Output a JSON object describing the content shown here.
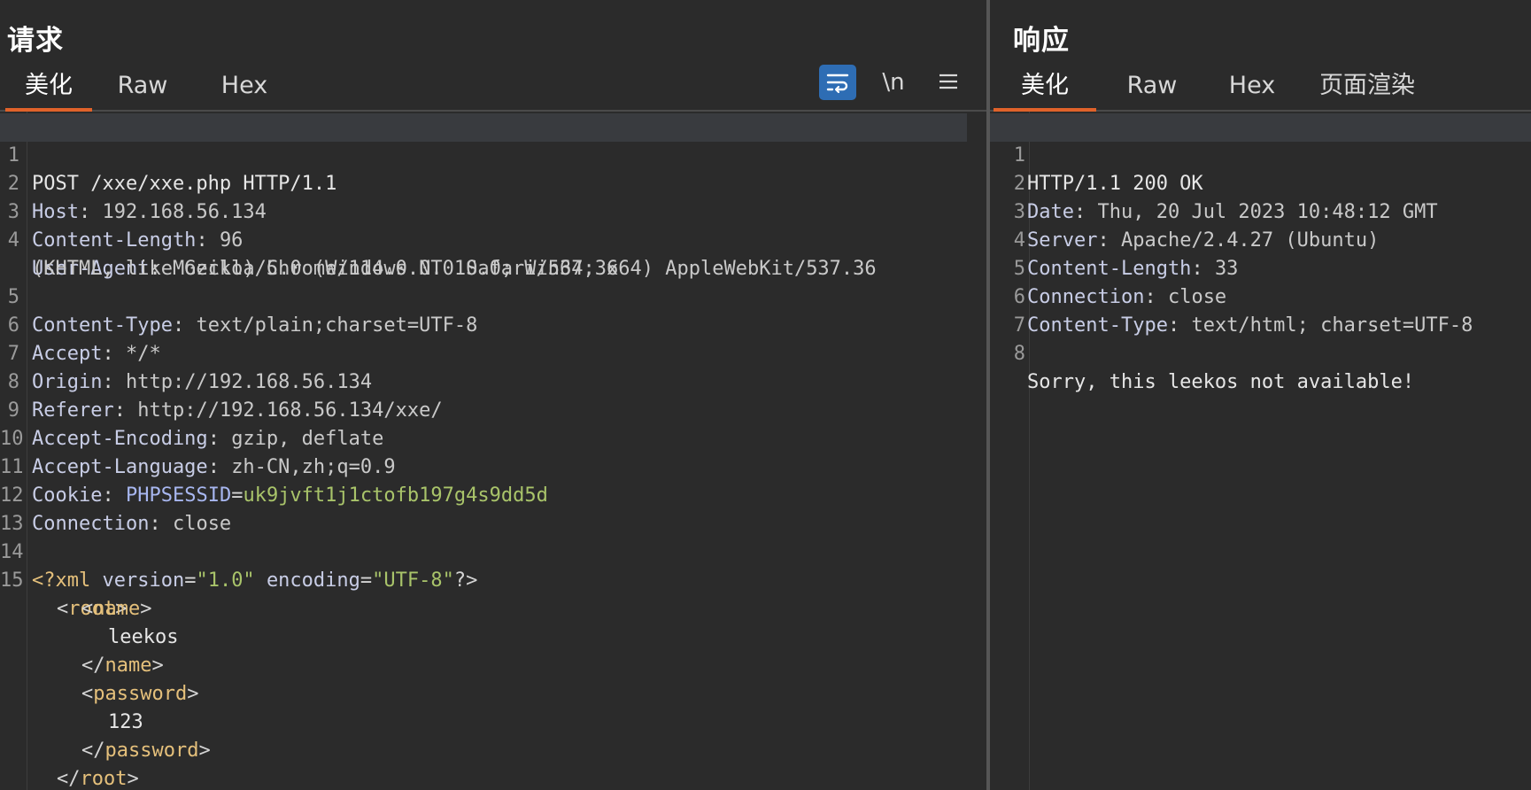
{
  "request": {
    "title": "请求",
    "tabs": [
      "美化",
      "Raw",
      "Hex"
    ],
    "tools": {
      "wrap": "wrap-icon",
      "newline": "\\n",
      "menu": "menu-icon"
    },
    "line_numbers": [
      "1",
      "2",
      "3",
      "4",
      "5",
      "6",
      "7",
      "8",
      "9",
      "10",
      "11",
      "12",
      "13",
      "14",
      "15"
    ],
    "request_line": "POST /xxe/xxe.php HTTP/1.1",
    "headers": [
      {
        "key": "Host",
        "value": "192.168.56.134"
      },
      {
        "key": "Content-Length",
        "value": "96"
      },
      {
        "key": "User-Agent",
        "value": "Mozilla/5.0 (Windows NT 10.0; Win64; x64) AppleWebKit/537.36"
      },
      {
        "key": "",
        "value": "(KHTML, like Gecko) Chrome/114.0.0.0 Safari/537.36"
      },
      {
        "key": "Content-Type",
        "value": "text/plain;charset=UTF-8"
      },
      {
        "key": "Accept",
        "value": "*/*"
      },
      {
        "key": "Origin",
        "value": "http://192.168.56.134"
      },
      {
        "key": "Referer",
        "value": "http://192.168.56.134/xxe/"
      },
      {
        "key": "Accept-Encoding",
        "value": "gzip, deflate"
      },
      {
        "key": "Accept-Language",
        "value": "zh-CN,zh;q=0.9"
      }
    ],
    "cookie": {
      "key": "Cookie",
      "name": "PHPSESSID",
      "value": "uk9jvft1j1ctofb197g4s9dd5d"
    },
    "connection": {
      "key": "Connection",
      "value": "close"
    },
    "xml": {
      "decl_open": "<?xml",
      "attr1": "version",
      "val1": "\"1.0\"",
      "attr2": "encoding",
      "val2": "\"UTF-8\"",
      "decl_close": "?>",
      "root": "root",
      "name_tag": "name",
      "name_value": "leekos",
      "password_tag": "password",
      "password_value": "123"
    }
  },
  "response": {
    "title": "响应",
    "tabs": [
      "美化",
      "Raw",
      "Hex",
      "页面渲染"
    ],
    "line_numbers": [
      "1",
      "2",
      "3",
      "4",
      "5",
      "6",
      "7",
      "8"
    ],
    "status_line": "HTTP/1.1 200 OK",
    "headers": [
      {
        "key": "Date",
        "value": "Thu, 20 Jul 2023 10:48:12 GMT"
      },
      {
        "key": "Server",
        "value": "Apache/2.4.27 (Ubuntu)"
      },
      {
        "key": "Content-Length",
        "value": "33"
      },
      {
        "key": "Connection",
        "value": "close"
      },
      {
        "key": "Content-Type",
        "value": "text/html; charset=UTF-8"
      }
    ],
    "body": "Sorry, this leekos not available!"
  }
}
